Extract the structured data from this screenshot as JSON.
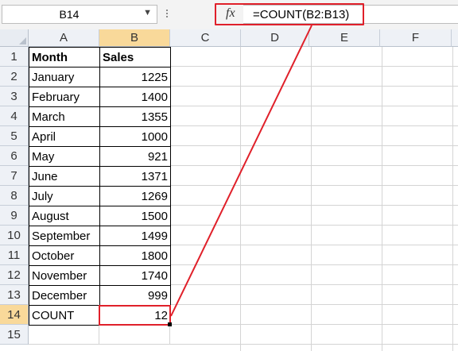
{
  "name_box": {
    "value": "B14",
    "dropdown_icon": "caret-down-icon"
  },
  "formula_bar": {
    "fx_label": "fx",
    "formula": "=COUNT(B2:B13)"
  },
  "column_headers": [
    "A",
    "B",
    "C",
    "D",
    "E",
    "F"
  ],
  "active_column": "B",
  "row_headers": [
    "1",
    "2",
    "3",
    "4",
    "5",
    "6",
    "7",
    "8",
    "9",
    "10",
    "11",
    "12",
    "13",
    "14",
    "15"
  ],
  "active_row": "14",
  "table": {
    "header": {
      "month": "Month",
      "sales": "Sales"
    },
    "rows": [
      {
        "month": "January",
        "sales": "1225"
      },
      {
        "month": "February",
        "sales": "1400"
      },
      {
        "month": "March",
        "sales": "1355"
      },
      {
        "month": "April",
        "sales": "1000"
      },
      {
        "month": "May",
        "sales": "921"
      },
      {
        "month": "June",
        "sales": "1371"
      },
      {
        "month": "July",
        "sales": "1269"
      },
      {
        "month": "August",
        "sales": "1500"
      },
      {
        "month": "September",
        "sales": "1499"
      },
      {
        "month": "October",
        "sales": "1800"
      },
      {
        "month": "November",
        "sales": "1740"
      },
      {
        "month": "December",
        "sales": "999"
      }
    ],
    "count_label": "COUNT",
    "count_value": "12"
  },
  "colors": {
    "highlight": "#e0202a",
    "active_header": "#f9d99a",
    "header_bg": "#eef1f6"
  }
}
